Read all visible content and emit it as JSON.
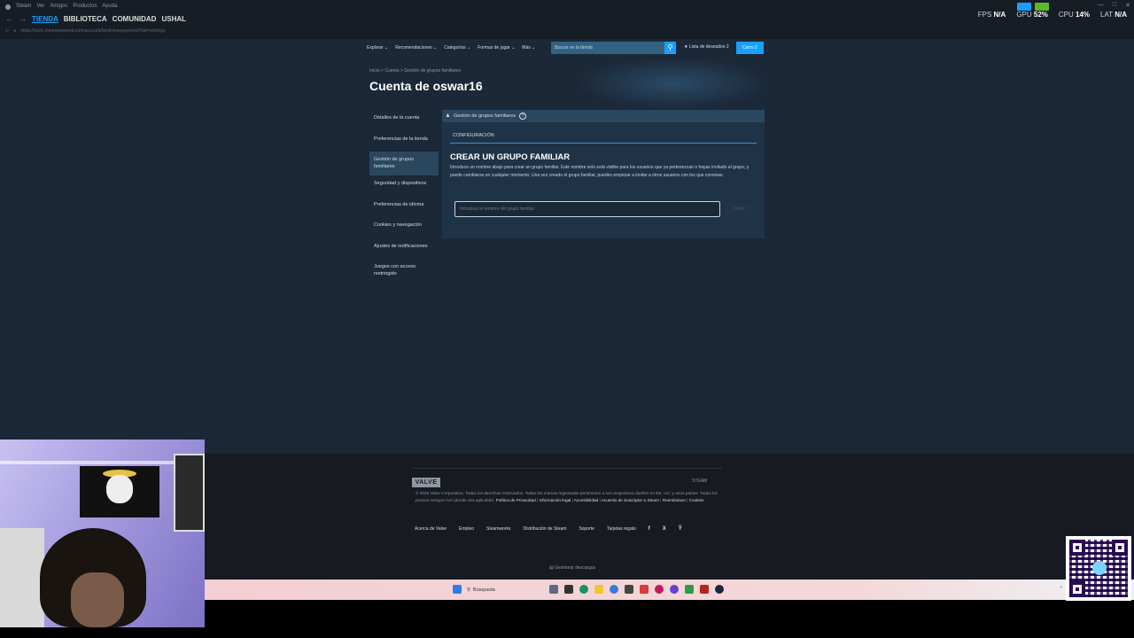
{
  "client": {
    "menu": [
      "Steam",
      "Ver",
      "Amigos",
      "Productos",
      "Ayuda"
    ],
    "nav": [
      "TIENDA",
      "BIBLIOTECA",
      "COMUNIDAD",
      "USHAL"
    ],
    "url": "https://store.steampowered.com/account/familymanagement?tab=settings"
  },
  "perf": {
    "fps_label": "FPS",
    "fps_value": "N/A",
    "gpu_label": "GPU",
    "gpu_value": "52%",
    "cpu_label": "CPU",
    "cpu_value": "14%",
    "lat_label": "LAT",
    "lat_value": "N/A"
  },
  "store": {
    "nav": [
      "Explorar",
      "Recomendaciones",
      "Categorías",
      "Formas de jugar",
      "Más"
    ],
    "search_placeholder": "Buscar en la tienda",
    "wishlist": "★ Lista de deseados 2",
    "cart": "Carro 2",
    "breadcrumb": "Inicio > Cuenta > Gestión de grupos familiares",
    "title": "Cuenta de oswar16",
    "sidebar": [
      "Detalles de la cuenta",
      "Preferencias de la tienda",
      "Gestión de grupos familiares",
      "Seguridad y dispositivos",
      "Preferencias de idioma",
      "Cookies y navegación",
      "Ajustes de notificaciones",
      "Juegos con acceso restringido"
    ],
    "panel_title": "Gestión de grupos familiares",
    "tab": "CONFIGURACIÓN",
    "create_title": "CREAR UN GRUPO FAMILIAR",
    "create_desc": "Introduce un nombre abajo para crear un grupo familiar. Este nombre solo está visible para los usuarios que ya pertenezcan o hayas invitado al grupo, y puede cambiarse en cualquier momento. Una vez creado el grupo familiar, puedes empezar a invitar a otros usuarios con los que convivas.",
    "input_placeholder": "Introduce el nombre del grupo familiar",
    "create_button": "Crear"
  },
  "footer": {
    "valve": "VALVE",
    "steam": "STEAM",
    "legal": "© 2025 Valve Corporation. Todos los derechos reservados. Todas las marcas registradas pertenecen a sus respectivos dueños en EE. UU. y otros países. Todos los precios incluyen IVA (donde sea aplicable).",
    "legal_links": [
      "Política de Privacidad",
      "Información legal",
      "Accesibilidad",
      "Acuerdo de Suscriptor a Steam",
      "Reembolsos",
      "Cookies"
    ],
    "links": [
      "Acerca de Valve",
      "Empleo",
      "Steamworks",
      "Distribución de Steam",
      "Soporte",
      "Tarjetas regalo"
    ],
    "social": [
      "f",
      "X",
      "Ŷ"
    ],
    "downloads": "Gestionar descargas"
  },
  "taskbar": {
    "search": "Búsqueda"
  },
  "colors": {
    "accent": "#1a9fff",
    "page_bg": "#1b2838",
    "panel_bg": "#1f3347",
    "footer_bg": "#171a21"
  }
}
